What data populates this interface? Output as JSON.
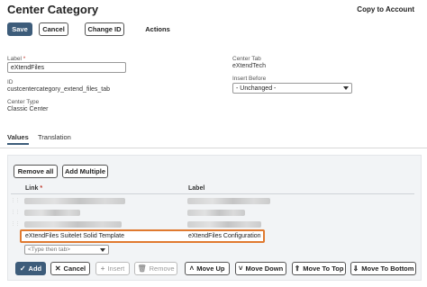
{
  "header": {
    "title": "Center Category",
    "copy_to_account": "Copy to Account"
  },
  "toolbar": {
    "save": "Save",
    "cancel": "Cancel",
    "change_id": "Change ID",
    "actions": "Actions"
  },
  "form": {
    "label_label": "Label",
    "label_required": "*",
    "label_value": "eXtendFiles",
    "id_label": "ID",
    "id_value": "custcentercategory_extend_files_tab",
    "center_type_label": "Center Type",
    "center_type_value": "Classic Center",
    "center_tab_label": "Center Tab",
    "center_tab_value": "eXtendTech",
    "insert_before_label": "Insert Before",
    "insert_before_value": "- Unchanged -"
  },
  "tabs": [
    {
      "label": "Values"
    },
    {
      "label": "Translation"
    }
  ],
  "sublist": {
    "remove_all": "Remove all",
    "add_multiple": "Add Multiple",
    "col_link": "Link",
    "col_link_required": "*",
    "col_label": "Label",
    "highlighted_row": {
      "link": "eXtendFiles Suitelet Solid Template",
      "label": "eXtendFiles Configuration"
    },
    "new_row_placeholder": "<Type then tab>"
  },
  "row_actions": {
    "add": "Add",
    "cancel": "Cancel",
    "insert": "Insert",
    "remove": "Remove",
    "move_up": "Move Up",
    "move_down": "Move Down",
    "move_to_top": "Move To Top",
    "move_to_bottom": "Move To Bottom"
  },
  "colors": {
    "primary": "#3d5c7a",
    "highlight": "#e07a30"
  }
}
